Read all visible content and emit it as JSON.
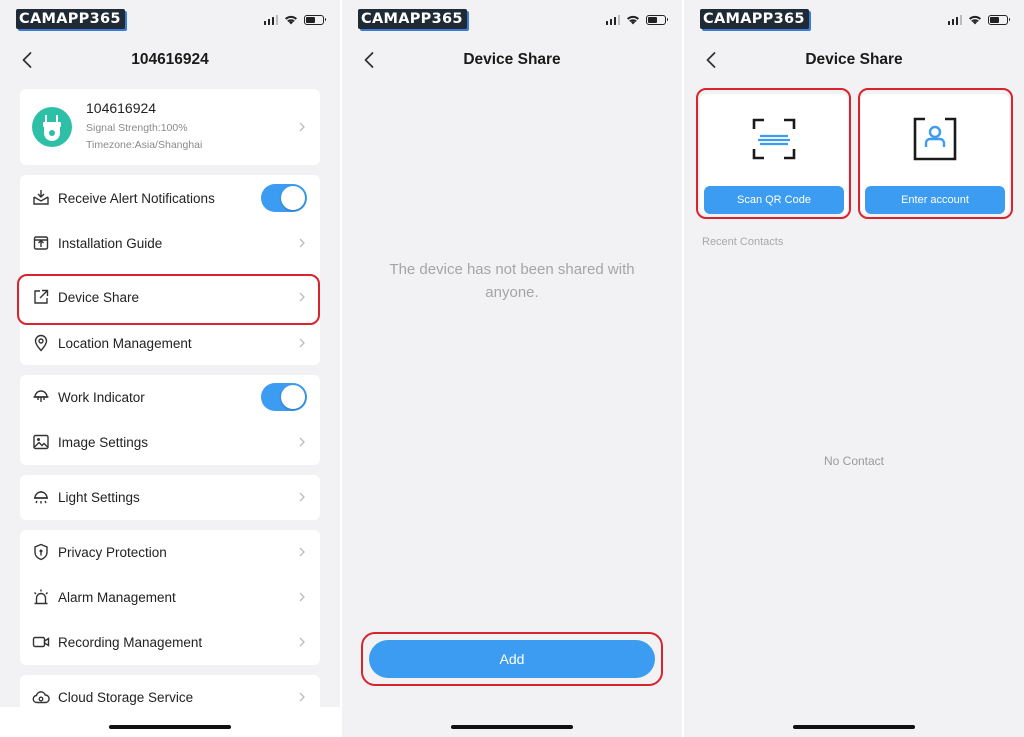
{
  "watermark": "CAMAPP365",
  "colors": {
    "accent": "#3b9cf1",
    "highlight": "#d9232d",
    "avatar": "#2ec0a7"
  },
  "panel1": {
    "title": "104616924",
    "device": {
      "name": "104616924",
      "signal": "Signal Strength:100%",
      "timezone": "Timezone:Asia/Shanghai",
      "icon": "camera-icon"
    },
    "items": [
      {
        "label": "Receive Alert Notifications",
        "icon": "alert-notification-icon",
        "toggle": true,
        "toggle_on": true
      },
      {
        "label": "Installation Guide",
        "icon": "install-guide-icon"
      },
      {
        "label": "Device Share",
        "icon": "share-icon",
        "highlighted": true
      },
      {
        "label": "Location Management",
        "icon": "location-pin-icon"
      },
      {
        "label": "Work Indicator",
        "icon": "work-indicator-icon",
        "toggle": true,
        "toggle_on": true
      },
      {
        "label": "Image Settings",
        "icon": "image-icon"
      },
      {
        "label": "Light Settings",
        "icon": "light-icon"
      },
      {
        "label": "Privacy Protection",
        "icon": "privacy-shield-icon"
      },
      {
        "label": "Alarm Management",
        "icon": "alarm-icon"
      },
      {
        "label": "Recording Management",
        "icon": "recording-icon"
      },
      {
        "label": "Cloud Storage Service",
        "icon": "cloud-storage-icon"
      }
    ]
  },
  "panel2": {
    "title": "Device Share",
    "empty_message": "The device has not been shared with anyone.",
    "add_label": "Add"
  },
  "panel3": {
    "title": "Device Share",
    "scan_label": "Scan QR Code",
    "enter_label": "Enter account",
    "recent_label": "Recent Contacts",
    "no_contact": "No Contact"
  }
}
